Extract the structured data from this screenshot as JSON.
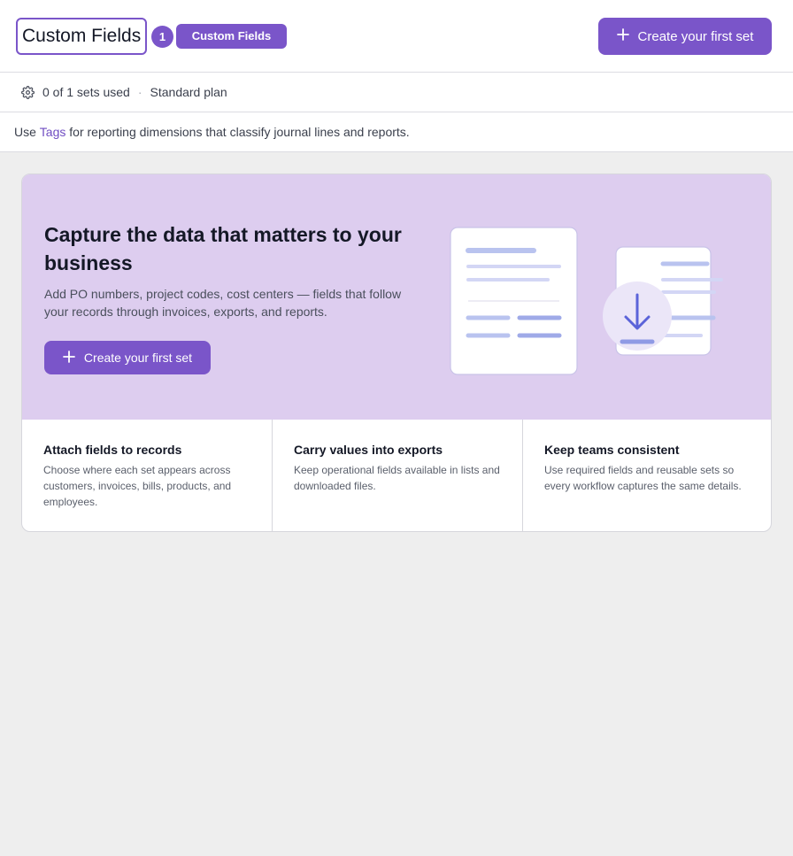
{
  "header": {
    "title": "Custom Fields",
    "count_badge": "1",
    "name_badge": "Custom Fields",
    "create_button_label": "Create your first set"
  },
  "usage": {
    "sets_used": "0 of 1 sets used",
    "separator": "·",
    "plan": "Standard plan"
  },
  "tags_note": {
    "before": "Use ",
    "link": "Tags",
    "after": " for reporting dimensions that classify journal lines and reports."
  },
  "hero": {
    "title": "Capture the data that matters to your business",
    "description": "Add PO numbers, project codes, cost centers — fields that follow your records through invoices, exports, and reports.",
    "button_label": "Create your first set"
  },
  "features": [
    {
      "title": "Attach fields to records",
      "description": "Choose where each set appears across customers, invoices, bills, products, and employees."
    },
    {
      "title": "Carry values into exports",
      "description": "Keep operational fields available in lists and downloaded files."
    },
    {
      "title": "Keep teams consistent",
      "description": "Use required fields and reusable sets so every workflow captures the same details."
    }
  ],
  "colors": {
    "accent": "#7a55c9",
    "hero_background": "#ddcdef",
    "page_background": "#eeeeee"
  },
  "icons": {
    "plus": "plus-icon",
    "gear": "gear-icon",
    "download": "download-arrow-icon"
  }
}
